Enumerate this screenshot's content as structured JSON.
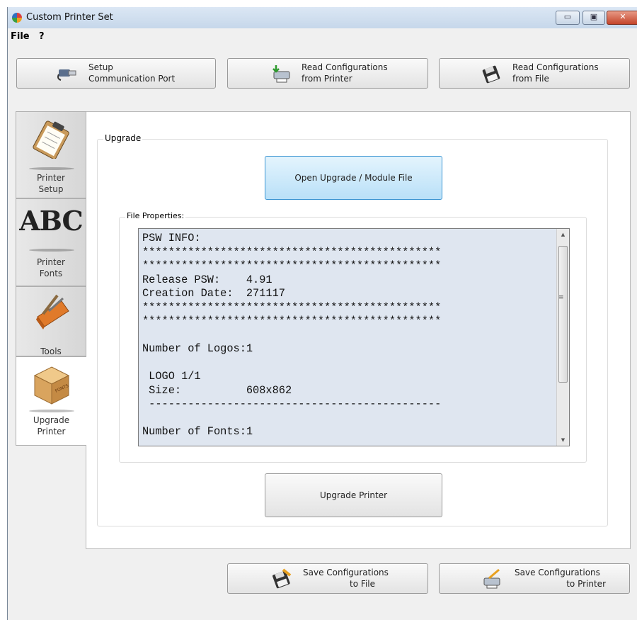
{
  "window": {
    "title": "Custom Printer Set"
  },
  "menu": {
    "items": [
      "File",
      "?"
    ]
  },
  "toolbar": {
    "setup_port": {
      "line1": "Setup",
      "line2": "Communication Port"
    },
    "read_printer": {
      "line1": "Read Configurations",
      "line2": "from Printer"
    },
    "read_file": {
      "line1": "Read Configurations",
      "line2": "from File"
    }
  },
  "tabs": [
    {
      "line1": "Printer",
      "line2": "Setup",
      "icon": "clipboard-icon"
    },
    {
      "line1": "Printer",
      "line2": "Fonts",
      "icon": "abc-font-icon",
      "glyph": "ABC"
    },
    {
      "line1": "Tools",
      "line2": "",
      "icon": "toolbox-icon"
    },
    {
      "line1": "Upgrade",
      "line2": "Printer",
      "icon": "package-icon",
      "active": true,
      "box_text": "FONTS"
    }
  ],
  "upgrade": {
    "group_label": "Upgrade",
    "open_button": "Open Upgrade / Module File",
    "file_properties_label": "File Properties:",
    "file_properties_text": "PSW INFO:\n**********************************************\n**********************************************\nRelease PSW:    4.91\nCreation Date:  271117\n**********************************************\n**********************************************\n\nNumber of Logos:1\n\n LOGO 1/1\n Size:          608x862\n ---------------------------------------------\n\nNumber of Fonts:1",
    "upgrade_button": "Upgrade Printer"
  },
  "bottom": {
    "save_file": {
      "line1": "Save Configurations",
      "line2": "to File"
    },
    "save_printer": {
      "line1": "Save Configurations",
      "line2": "to Printer"
    }
  },
  "colors": {
    "accent_button_top": "#d5ecfa",
    "accent_button_border": "#3c95d2",
    "textbox_bg": "#dfe6f0"
  }
}
